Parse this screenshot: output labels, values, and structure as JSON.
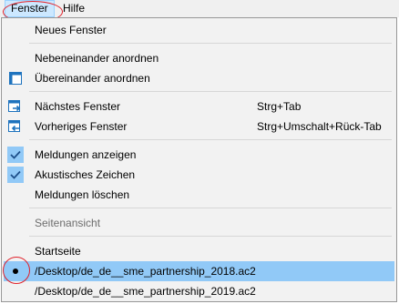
{
  "menubar": {
    "fenster": "Fenster",
    "hilfe": "Hilfe"
  },
  "menu": {
    "neues_fenster": "Neues Fenster",
    "nebeneinander": "Nebeneinander anordnen",
    "uebereinander": "Übereinander anordnen",
    "naechstes": "Nächstes Fenster",
    "naechstes_shortcut": "Strg+Tab",
    "vorheriges": "Vorheriges Fenster",
    "vorheriges_shortcut": "Strg+Umschalt+Rück-Tab",
    "meldungen_anzeigen": "Meldungen anzeigen",
    "akustisches": "Akustisches Zeichen",
    "meldungen_loeschen": "Meldungen löschen",
    "seitenansicht": "Seitenansicht",
    "startseite": "Startseite",
    "file1": "/Desktop/de_de__sme_partnership_2018.ac2",
    "file2": "/Desktop/de_de__sme_partnership_2019.ac2"
  },
  "colors": {
    "highlight": "#91c9f7",
    "annotation": "#e0202a",
    "icon_blue": "#1e73be"
  }
}
